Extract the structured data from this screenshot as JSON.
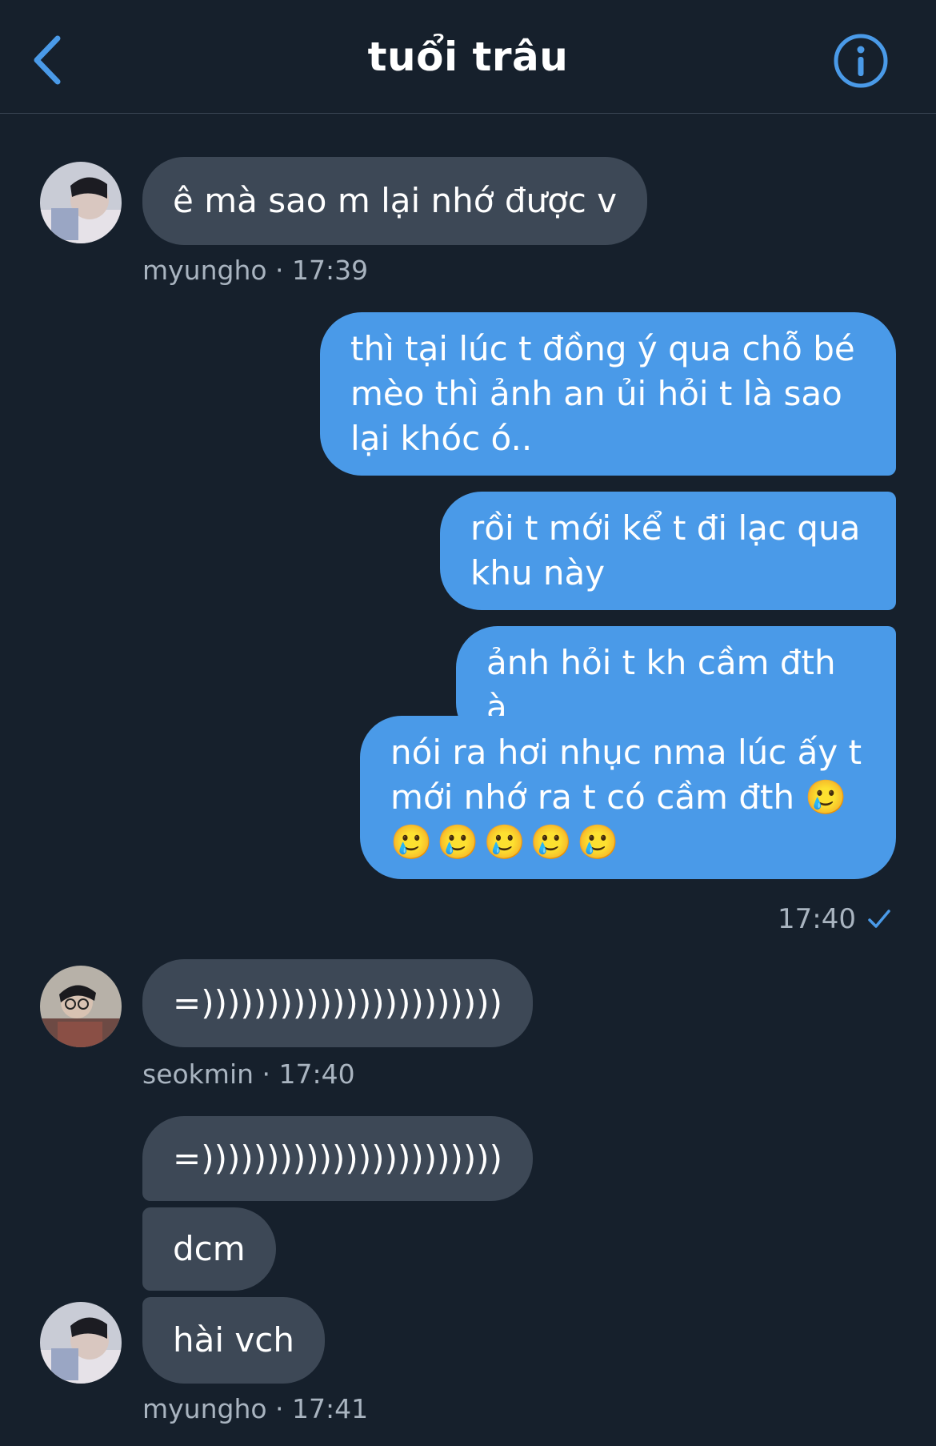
{
  "header": {
    "title": "tuổi trâu",
    "back_icon": "chevron-left-icon",
    "info_icon": "info-circle-icon",
    "accent": "#4a9ae8"
  },
  "messages": [
    {
      "id": "m1",
      "direction": "received",
      "text": "ê mà sao m lại nhớ được v"
    },
    {
      "id": "m1_meta",
      "sender": "myungho",
      "time": "17:39",
      "label": "myungho · 17:39"
    },
    {
      "id": "m2",
      "direction": "sent",
      "line1": "thì tại lúc t đồng ý qua chỗ bé",
      "line2": "mèo thì ảnh an ủi hỏi t là sao",
      "line3": "lại khóc ó.."
    },
    {
      "id": "m3",
      "direction": "sent",
      "line1": "rồi t mới kể t đi lạc qua",
      "line2": "khu này"
    },
    {
      "id": "m4",
      "direction": "sent",
      "text": "ảnh hỏi t kh cầm đth à"
    },
    {
      "id": "m5",
      "direction": "sent",
      "line1": "nói ra hơi nhục nma lúc ấy t",
      "line2": "mới nhớ ra t có cầm đth 🥲",
      "line3": "🥲🥲🥲🥲🥲"
    },
    {
      "id": "m5_meta",
      "time": "17:40",
      "status_icon": "checkmark-icon"
    },
    {
      "id": "m6",
      "direction": "received",
      "text": "=)))))))))))))))))))))))"
    },
    {
      "id": "m6_meta",
      "sender": "seokmin",
      "time": "17:40",
      "label": "seokmin · 17:40"
    },
    {
      "id": "m7",
      "direction": "received",
      "text": "=)))))))))))))))))))))))"
    },
    {
      "id": "m8",
      "direction": "received",
      "text": "dcm"
    },
    {
      "id": "m9",
      "direction": "received",
      "text": "hài vch"
    },
    {
      "id": "m9_meta",
      "sender": "myungho",
      "time": "17:41",
      "label": "myungho · 17:41"
    }
  ],
  "colors": {
    "background": "#16202c",
    "received_bubble": "#3d4856",
    "sent_bubble": "#4a9ae8",
    "meta_text": "#a9b4c0"
  }
}
